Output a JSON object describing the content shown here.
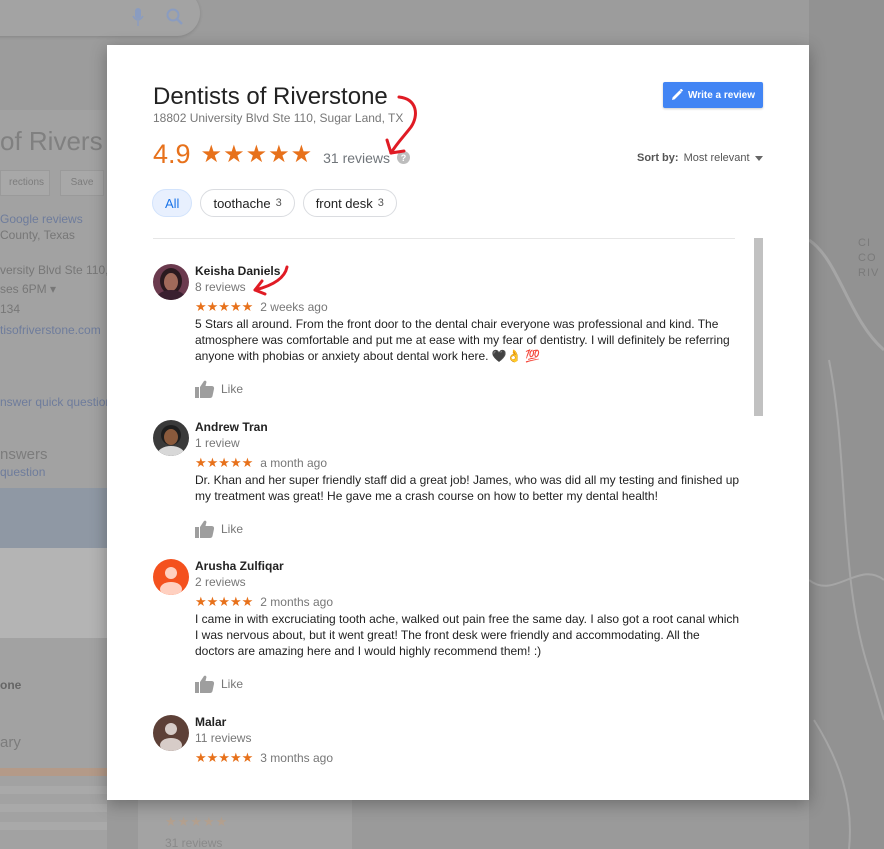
{
  "background": {
    "title_fragment": "of Rivers",
    "btn_directions": "rections",
    "btn_save": "Save",
    "google_reviews": "Google reviews",
    "county": "County, Texas",
    "address_fragment": "versity Blvd Ste 110,",
    "hours_fragment": "ses 6PM ▾",
    "phone_fragment": "134",
    "website_fragment": "tisofriverstone.com",
    "qa_link": "nswer quick question",
    "answers_heading": "nswers",
    "question_link": "question",
    "summary_name": "one",
    "summary_heading": "ary",
    "map_label": "CI\nCO\nRIV",
    "bottom_stars": "★★★★★",
    "bottom_reviews": "31 reviews"
  },
  "modal": {
    "business_name": "Dentists of Riverstone",
    "address": "18802 University Blvd Ste 110, Sugar Land, TX",
    "write_review_label": "Write a review",
    "rating": "4.9",
    "rating_stars": "★★★★★",
    "review_count": "31 reviews",
    "sort_label": "Sort by:",
    "sort_value": "Most relevant",
    "chips": [
      {
        "label": "All",
        "count": ""
      },
      {
        "label": "toothache",
        "count": "3"
      },
      {
        "label": "front desk",
        "count": "3"
      }
    ],
    "reviews": [
      {
        "name": "Keisha Daniels",
        "meta": "8 reviews",
        "stars": "★★★★★",
        "date": "2 weeks ago",
        "text": "5 Stars all around. From the front door to the dental chair everyone was professional and kind. The atmosphere was comfortable and put me at ease with my fear of dentistry. I will definitely be referring anyone with phobias or anxiety about dental work here. 🖤👌 💯",
        "like": "Like"
      },
      {
        "name": "Andrew Tran",
        "meta": "1 review",
        "stars": "★★★★★",
        "date": "a month ago",
        "text": "Dr. Khan and her super friendly staff did a great job! James, who was did all my testing and finished up my treatment was great! He gave me a crash course on how to better my dental health!",
        "like": "Like"
      },
      {
        "name": "Arusha Zulfiqar",
        "meta": "2 reviews",
        "stars": "★★★★★",
        "date": "2 months ago",
        "text": "I came in with excruciating tooth ache, walked out pain free the same day. I also got a root canal which I was nervous about, but it went great! The front desk were friendly and accommodating. All the doctors are amazing here and I would highly recommend them! :)",
        "like": "Like"
      },
      {
        "name": "Malar",
        "meta": "11 reviews",
        "stars": "★★★★★",
        "date": "3 months ago"
      }
    ]
  },
  "colors": {
    "accent_orange": "#e7711b",
    "button_blue": "#4285f4",
    "annotation_red": "#e01b24"
  }
}
